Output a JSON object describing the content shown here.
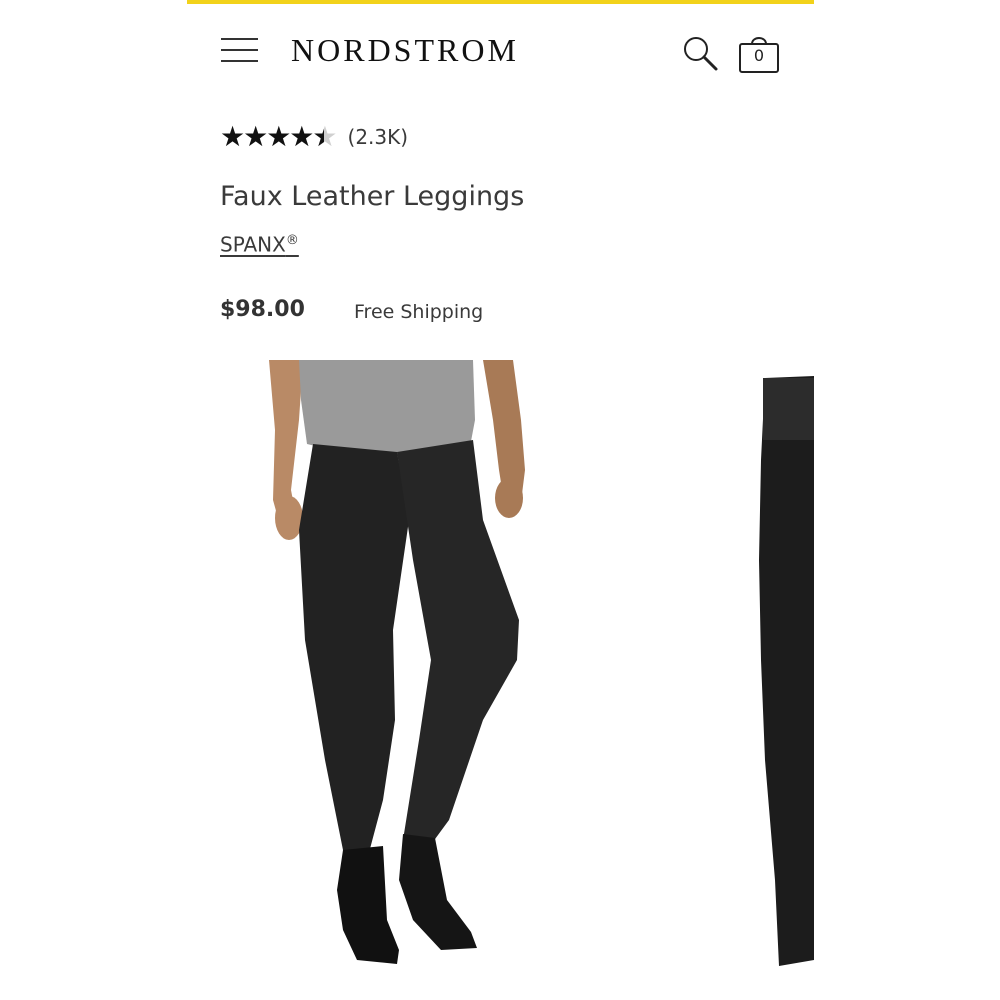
{
  "colors": {
    "accent": "#f2d21a",
    "text": "#3a3a3a",
    "star": "#111111"
  },
  "header": {
    "menu_icon": "hamburger-menu-icon",
    "logo": "NORDSTROM",
    "search_icon": "search-icon",
    "bag_icon": "shopping-bag-icon",
    "bag_count": "0"
  },
  "product": {
    "rating": 4.5,
    "stars_glyphs": "★★★★★",
    "review_count": "(2.3K)",
    "title": "Faux Leather Leggings",
    "brand": "SPANX",
    "brand_mark": "®",
    "price": "$98.00",
    "shipping": "Free Shipping"
  },
  "gallery": {
    "images": [
      {
        "description_icon": "model-wearing-leggings-photo"
      },
      {
        "description_icon": "leggings-side-photo"
      }
    ]
  }
}
